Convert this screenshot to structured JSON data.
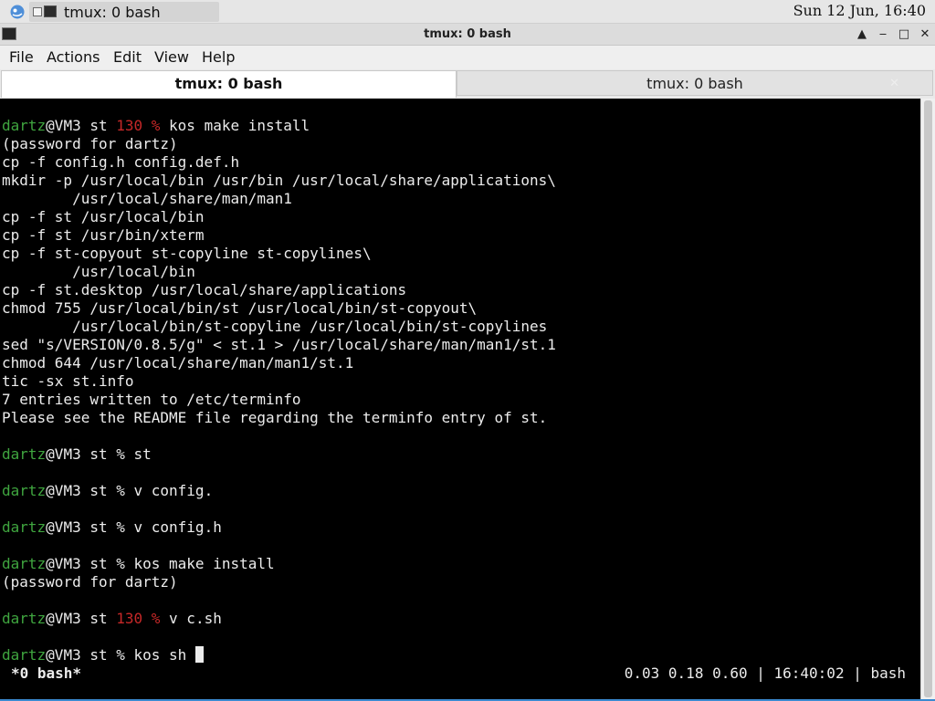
{
  "taskbar": {
    "task_label": "tmux: 0 bash",
    "clock": "Sun 12 Jun, 16:40"
  },
  "window": {
    "title": "tmux: 0 bash",
    "controls": {
      "keep_above": "▲",
      "minimize": "‒",
      "maximize": "□",
      "close": "✕"
    }
  },
  "menu": [
    "File",
    "Actions",
    "Edit",
    "View",
    "Help"
  ],
  "tabs": [
    {
      "label": "tmux: 0 bash",
      "active": true
    },
    {
      "label": "tmux: 0 bash",
      "active": false,
      "close": "✕"
    }
  ],
  "terminal": {
    "lines": [
      {
        "segments": [
          {
            "t": "dartz",
            "c": "user"
          },
          {
            "t": "@VM3 st "
          },
          {
            "t": "130 %",
            "c": "err"
          },
          {
            "t": " kos make install"
          }
        ]
      },
      {
        "segments": [
          {
            "t": "(password for dartz)"
          }
        ]
      },
      {
        "segments": [
          {
            "t": "cp -f config.h config.def.h"
          }
        ]
      },
      {
        "segments": [
          {
            "t": "mkdir -p /usr/local/bin /usr/bin /usr/local/share/applications\\"
          }
        ]
      },
      {
        "segments": [
          {
            "t": "        /usr/local/share/man/man1"
          }
        ]
      },
      {
        "segments": [
          {
            "t": "cp -f st /usr/local/bin"
          }
        ]
      },
      {
        "segments": [
          {
            "t": "cp -f st /usr/bin/xterm"
          }
        ]
      },
      {
        "segments": [
          {
            "t": "cp -f st-copyout st-copyline st-copylines\\"
          }
        ]
      },
      {
        "segments": [
          {
            "t": "        /usr/local/bin"
          }
        ]
      },
      {
        "segments": [
          {
            "t": "cp -f st.desktop /usr/local/share/applications"
          }
        ]
      },
      {
        "segments": [
          {
            "t": "chmod 755 /usr/local/bin/st /usr/local/bin/st-copyout\\"
          }
        ]
      },
      {
        "segments": [
          {
            "t": "        /usr/local/bin/st-copyline /usr/local/bin/st-copylines"
          }
        ]
      },
      {
        "segments": [
          {
            "t": "sed \"s/VERSION/0.8.5/g\" < st.1 > /usr/local/share/man/man1/st.1"
          }
        ]
      },
      {
        "segments": [
          {
            "t": "chmod 644 /usr/local/share/man/man1/st.1"
          }
        ]
      },
      {
        "segments": [
          {
            "t": "tic -sx st.info"
          }
        ]
      },
      {
        "segments": [
          {
            "t": "7 entries written to /etc/terminfo"
          }
        ]
      },
      {
        "segments": [
          {
            "t": "Please see the README file regarding the terminfo entry of st."
          }
        ]
      },
      {
        "segments": []
      },
      {
        "segments": [
          {
            "t": "dartz",
            "c": "user"
          },
          {
            "t": "@VM3 st % st"
          }
        ]
      },
      {
        "segments": []
      },
      {
        "segments": [
          {
            "t": "dartz",
            "c": "user"
          },
          {
            "t": "@VM3 st % v config."
          }
        ]
      },
      {
        "segments": []
      },
      {
        "segments": [
          {
            "t": "dartz",
            "c": "user"
          },
          {
            "t": "@VM3 st % v config.h"
          }
        ]
      },
      {
        "segments": []
      },
      {
        "segments": [
          {
            "t": "dartz",
            "c": "user"
          },
          {
            "t": "@VM3 st % kos make install"
          }
        ]
      },
      {
        "segments": [
          {
            "t": "(password for dartz)"
          }
        ]
      },
      {
        "segments": []
      },
      {
        "segments": [
          {
            "t": "dartz",
            "c": "user"
          },
          {
            "t": "@VM3 st "
          },
          {
            "t": "130 %",
            "c": "err"
          },
          {
            "t": " v c.sh"
          }
        ]
      },
      {
        "segments": []
      },
      {
        "segments": [
          {
            "t": "dartz",
            "c": "user"
          },
          {
            "t": "@VM3 st % kos sh "
          }
        ],
        "cursor": true
      }
    ],
    "status_left": "*0 bash*",
    "status_right": "0.03 0.18 0.60 | 16:40:02 | bash"
  },
  "colors": {
    "user": "#3fa53f",
    "error": "#c62828",
    "terminal_bg": "#000000",
    "terminal_fg": "#ececec",
    "accent": "#3a8ad0"
  },
  "icons": {
    "start": "app-launcher-icon",
    "task": "terminal-icon",
    "window": "terminal-icon"
  }
}
